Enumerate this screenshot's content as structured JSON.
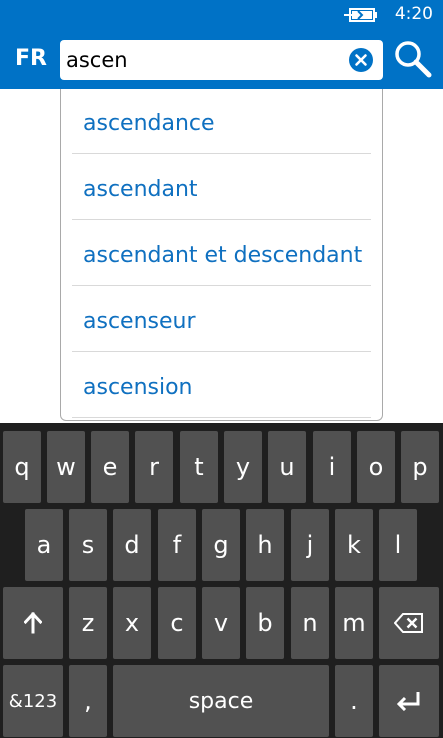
{
  "status": {
    "time": "4:20",
    "battery_icon": "battery-charging-icon"
  },
  "header": {
    "language": "FR",
    "search_value": "ascen",
    "clear_icon": "clear-icon",
    "search_icon": "search-icon",
    "accent_color": "#0072c6"
  },
  "suggestions": [
    "ascendance",
    "ascendant",
    "ascendant et descendant",
    "ascenseur",
    "ascension"
  ],
  "keyboard": {
    "row1": [
      "q",
      "w",
      "e",
      "r",
      "t",
      "y",
      "u",
      "i",
      "o",
      "p"
    ],
    "row2": [
      "a",
      "s",
      "d",
      "f",
      "g",
      "h",
      "j",
      "k",
      "l"
    ],
    "row3": [
      "z",
      "x",
      "c",
      "v",
      "b",
      "n",
      "m"
    ],
    "shift_icon": "shift-arrow-icon",
    "backspace_icon": "backspace-icon",
    "numbers_label": "&123",
    "comma_label": ",",
    "space_label": "space",
    "period_label": ".",
    "enter_icon": "enter-icon"
  }
}
